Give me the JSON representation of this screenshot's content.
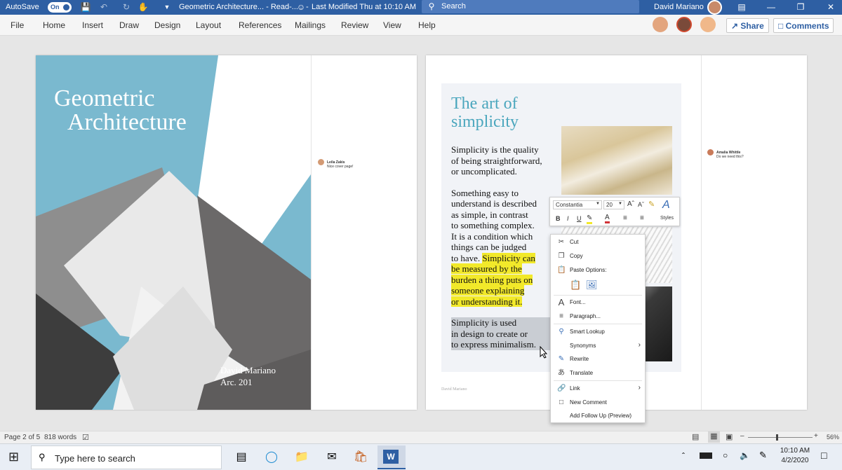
{
  "titlebar": {
    "autosave_label": "AutoSave",
    "autosave_state": "On",
    "doc_title": "Geometric Architecture... - Read-...",
    "modified": "Last Modified Thu at 10:10 AM",
    "search_placeholder": "Search",
    "user_name": "David Mariano",
    "accent": "#2e5fa3"
  },
  "menu": {
    "items": [
      "File",
      "Home",
      "Insert",
      "Draw",
      "Design",
      "Layout",
      "References",
      "Mailings",
      "Review",
      "View",
      "Help"
    ],
    "share_label": "Share",
    "comments_label": "Comments"
  },
  "cover": {
    "title_line1": "Geometric",
    "title_line2": "Architecture",
    "author": "David Mariano",
    "course": "Arc. 201"
  },
  "comment1": {
    "author": "Leila Zakis",
    "text": "Nice cover page!"
  },
  "comment2": {
    "author": "Amalia Whittle",
    "text": "Do we need this?"
  },
  "article": {
    "heading_line1": "The art of",
    "heading_line2": "simplicity",
    "p1": [
      "Simplicity is the quality",
      "of being straightforward,",
      "or uncomplicated."
    ],
    "p2_plain": [
      "Something easy to",
      "understand is described",
      "as simple, in contrast",
      "to something complex.",
      "It is a condition which",
      "things can be judged"
    ],
    "p2_last_plain": "to have. ",
    "p2_highlight": [
      "Simplicity can",
      "be measured by the",
      "burden a thing puts on",
      "someone explaining",
      "or understanding it."
    ],
    "p3_selected": [
      "Simplicity is used",
      "in design to create or",
      "to express minimalism."
    ],
    "footer": "David Mariano"
  },
  "minitoolbar": {
    "font": "Constantia",
    "size": "20",
    "bold": "B",
    "italic": "I",
    "underline": "U",
    "styles_label": "Styles"
  },
  "context_menu": {
    "cut": "Cut",
    "copy": "Copy",
    "paste_options": "Paste Options:",
    "font": "Font...",
    "paragraph": "Paragraph...",
    "smart_lookup": "Smart Lookup",
    "synonyms": "Synonyms",
    "rewrite": "Rewrite",
    "translate": "Translate",
    "link": "Link",
    "new_comment": "New Comment",
    "add_follow_up": "Add Follow Up (Preview)"
  },
  "status": {
    "page": "Page 2 of 5",
    "words": "818 words",
    "zoom": "56%"
  },
  "taskbar": {
    "search_placeholder": "Type here to search",
    "time": "10:10 AM",
    "date": "4/2/2020"
  }
}
